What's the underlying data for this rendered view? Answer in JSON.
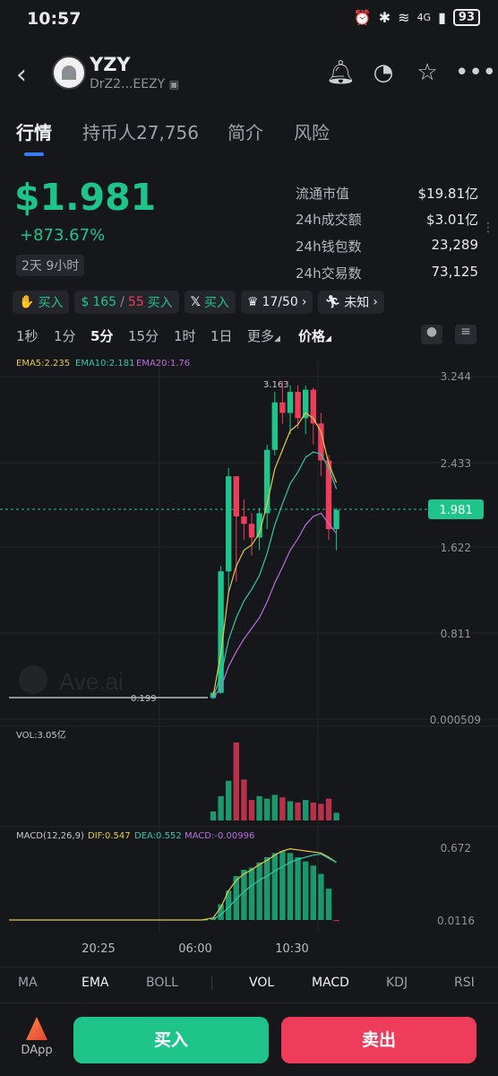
{
  "status": {
    "time": "10:57",
    "battery": "93",
    "net": "4G"
  },
  "token": {
    "name": "YZY",
    "address": "DrZ2...EEZY"
  },
  "tabs": [
    {
      "label": "行情"
    },
    {
      "label": "持币人27,756"
    },
    {
      "label": "简介"
    },
    {
      "label": "风险"
    }
  ],
  "price": {
    "value": "$1.981",
    "change": "+873.67%",
    "age": "2天 9小时"
  },
  "stats": [
    {
      "label": "流通市值",
      "value": "$19.81亿"
    },
    {
      "label": "24h成交额",
      "value": "$3.01亿"
    },
    {
      "label": "24h钱包数",
      "value": "23,289"
    },
    {
      "label": "24h交易数",
      "value": "73,125"
    }
  ],
  "tags": {
    "t1": "买入",
    "t2_a": "165",
    "t2_sep": "/",
    "t2_b": "55",
    "t2_c": "买入",
    "t3": "买入",
    "t4": "17/50",
    "t5": "未知"
  },
  "intervals": [
    "1秒",
    "1分",
    "5分",
    "15分",
    "1时",
    "1日",
    "更多",
    "价格"
  ],
  "ema_legend": {
    "ema5": "EMA5:2.235",
    "ema10": "EMA10:2.181",
    "ema20": "EMA20:1.76"
  },
  "price_axis": [
    "3.244",
    "2.433",
    "1.622",
    "0.811",
    "0.000509"
  ],
  "current_price_tag": "1.981",
  "high_label": "3.163",
  "low_label": "0.199",
  "watermark": "Ave.ai",
  "vol_legend": "VOL:3.05亿",
  "macd_legend": {
    "title": "MACD(12,26,9)",
    "dif": "DIF:0.547",
    "dea": "DEA:0.552",
    "macd": "MACD:-0.00996"
  },
  "macd_axis": [
    "0.672",
    "0.0116"
  ],
  "time_axis": [
    "20:25",
    "06:00",
    "10:30"
  ],
  "indicators": [
    "MA",
    "EMA",
    "BOLL",
    "VOL",
    "MACD",
    "KDJ",
    "RSI"
  ],
  "actions": {
    "dapp": "DApp",
    "buy": "买入",
    "sell": "卖出"
  },
  "colors": {
    "up": "#1fc48a",
    "down": "#ee3c5a",
    "accent": "#3a7bf5"
  },
  "chart_data": {
    "type": "candlestick",
    "candles": [
      {
        "o": 0.2,
        "h": 0.26,
        "l": 0.19,
        "c": 0.25
      },
      {
        "o": 0.25,
        "h": 1.45,
        "l": 0.24,
        "c": 1.4
      },
      {
        "o": 1.4,
        "h": 2.38,
        "l": 1.2,
        "c": 2.3
      },
      {
        "o": 2.3,
        "h": 2.3,
        "l": 1.3,
        "c": 1.92
      },
      {
        "o": 1.92,
        "h": 2.08,
        "l": 1.7,
        "c": 1.85
      },
      {
        "o": 1.85,
        "h": 1.95,
        "l": 1.55,
        "c": 1.72
      },
      {
        "o": 1.72,
        "h": 2.0,
        "l": 1.6,
        "c": 1.95
      },
      {
        "o": 1.95,
        "h": 2.6,
        "l": 1.8,
        "c": 2.55
      },
      {
        "o": 2.55,
        "h": 3.1,
        "l": 2.5,
        "c": 3.0
      },
      {
        "o": 3.0,
        "h": 3.2,
        "l": 2.8,
        "c": 2.9
      },
      {
        "o": 2.9,
        "h": 3.16,
        "l": 2.7,
        "c": 3.1
      },
      {
        "o": 3.1,
        "h": 3.163,
        "l": 2.75,
        "c": 2.85
      },
      {
        "o": 2.85,
        "h": 3.16,
        "l": 2.7,
        "c": 3.12
      },
      {
        "o": 3.12,
        "h": 3.14,
        "l": 2.6,
        "c": 2.8
      },
      {
        "o": 2.8,
        "h": 2.9,
        "l": 2.3,
        "c": 2.45
      },
      {
        "o": 2.45,
        "h": 2.5,
        "l": 1.7,
        "c": 1.8
      },
      {
        "o": 1.8,
        "h": 2.0,
        "l": 1.6,
        "c": 1.981
      }
    ],
    "volume": [
      0.35,
      0.95,
      1.55,
      3.05,
      1.6,
      0.8,
      0.95,
      0.85,
      1.0,
      0.9,
      0.75,
      0.7,
      0.8,
      0.7,
      0.65,
      0.85,
      0.3
    ],
    "macd_hist": [
      0.02,
      0.15,
      0.28,
      0.42,
      0.48,
      0.5,
      0.55,
      0.6,
      0.64,
      0.66,
      0.64,
      0.6,
      0.56,
      0.52,
      0.44,
      0.3,
      -0.01
    ],
    "dif": [
      0.02,
      0.12,
      0.28,
      0.38,
      0.44,
      0.48,
      0.53,
      0.57,
      0.62,
      0.66,
      0.68,
      0.67,
      0.66,
      0.65,
      0.64,
      0.6,
      0.55
    ],
    "dea": [
      0.01,
      0.05,
      0.12,
      0.2,
      0.27,
      0.33,
      0.38,
      0.42,
      0.47,
      0.51,
      0.55,
      0.58,
      0.6,
      0.62,
      0.63,
      0.59,
      0.55
    ],
    "ema5": [
      0.22,
      0.62,
      1.2,
      1.45,
      1.6,
      1.65,
      1.76,
      2.04,
      2.37,
      2.55,
      2.73,
      2.79,
      2.9,
      2.85,
      2.72,
      2.42,
      2.24
    ],
    "ema10": [
      0.21,
      0.41,
      0.75,
      0.96,
      1.12,
      1.23,
      1.36,
      1.57,
      1.84,
      2.04,
      2.23,
      2.34,
      2.48,
      2.53,
      2.51,
      2.38,
      2.18
    ],
    "ema20": [
      0.2,
      0.3,
      0.5,
      0.64,
      0.76,
      0.86,
      0.96,
      1.11,
      1.29,
      1.44,
      1.6,
      1.71,
      1.84,
      1.92,
      1.95,
      1.85,
      1.76
    ],
    "ylim": [
      0.000509,
      3.244
    ],
    "ema_colors": [
      "#e6c84a",
      "#35c7a8",
      "#b86fdd"
    ],
    "dif_color": "#e6c84a",
    "dea_color": "#35c7a8"
  }
}
